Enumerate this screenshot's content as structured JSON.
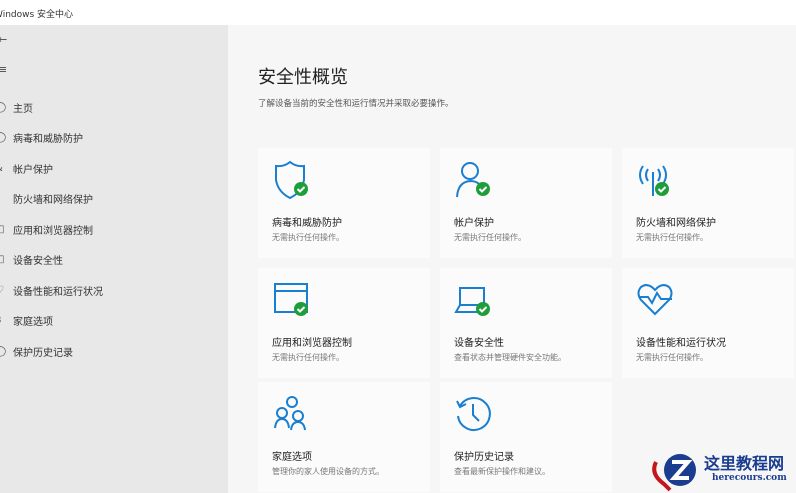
{
  "window": {
    "title": "Windows 安全中心"
  },
  "sidebar": {
    "items": [
      {
        "label": "主页",
        "icon": "home-icon"
      },
      {
        "label": "病毒和威胁防护",
        "icon": "shield-icon"
      },
      {
        "label": "帐户保护",
        "icon": "person-icon"
      },
      {
        "label": "防火墙和网络保护",
        "icon": "wifi-icon"
      },
      {
        "label": "应用和浏览器控制",
        "icon": "browser-icon"
      },
      {
        "label": "设备安全性",
        "icon": "laptop-icon"
      },
      {
        "label": "设备性能和运行状况",
        "icon": "heart-icon"
      },
      {
        "label": "家庭选项",
        "icon": "family-icon"
      },
      {
        "label": "保护历史记录",
        "icon": "history-icon"
      }
    ]
  },
  "main": {
    "title": "安全性概览",
    "subtitle": "了解设备当前的安全性和运行情况并采取必要操作。",
    "cards": [
      {
        "title": "病毒和威胁防护",
        "desc": "无需执行任何操作。",
        "icon": "shield-check-icon"
      },
      {
        "title": "帐户保护",
        "desc": "无需执行任何操作。",
        "icon": "person-check-icon"
      },
      {
        "title": "防火墙和网络保护",
        "desc": "无需执行任何操作。",
        "icon": "antenna-check-icon"
      },
      {
        "title": "应用和浏览器控制",
        "desc": "无需执行任何操作。",
        "icon": "browser-check-icon"
      },
      {
        "title": "设备安全性",
        "desc": "查看状态并管理硬件安全功能。",
        "icon": "laptop-check-icon"
      },
      {
        "title": "设备性能和运行状况",
        "desc": "无需执行任何操作。",
        "icon": "heart-pulse-icon"
      },
      {
        "title": "家庭选项",
        "desc": "管理你的家人使用设备的方式。",
        "icon": "family-icon"
      },
      {
        "title": "保护历史记录",
        "desc": "查看最新保护操作和建议。",
        "icon": "history-icon"
      }
    ]
  },
  "watermark": {
    "name": "这里教程网",
    "url": "herecours.com"
  },
  "colors": {
    "accent": "#1a7fd0",
    "ok": "#1e9e3a"
  }
}
